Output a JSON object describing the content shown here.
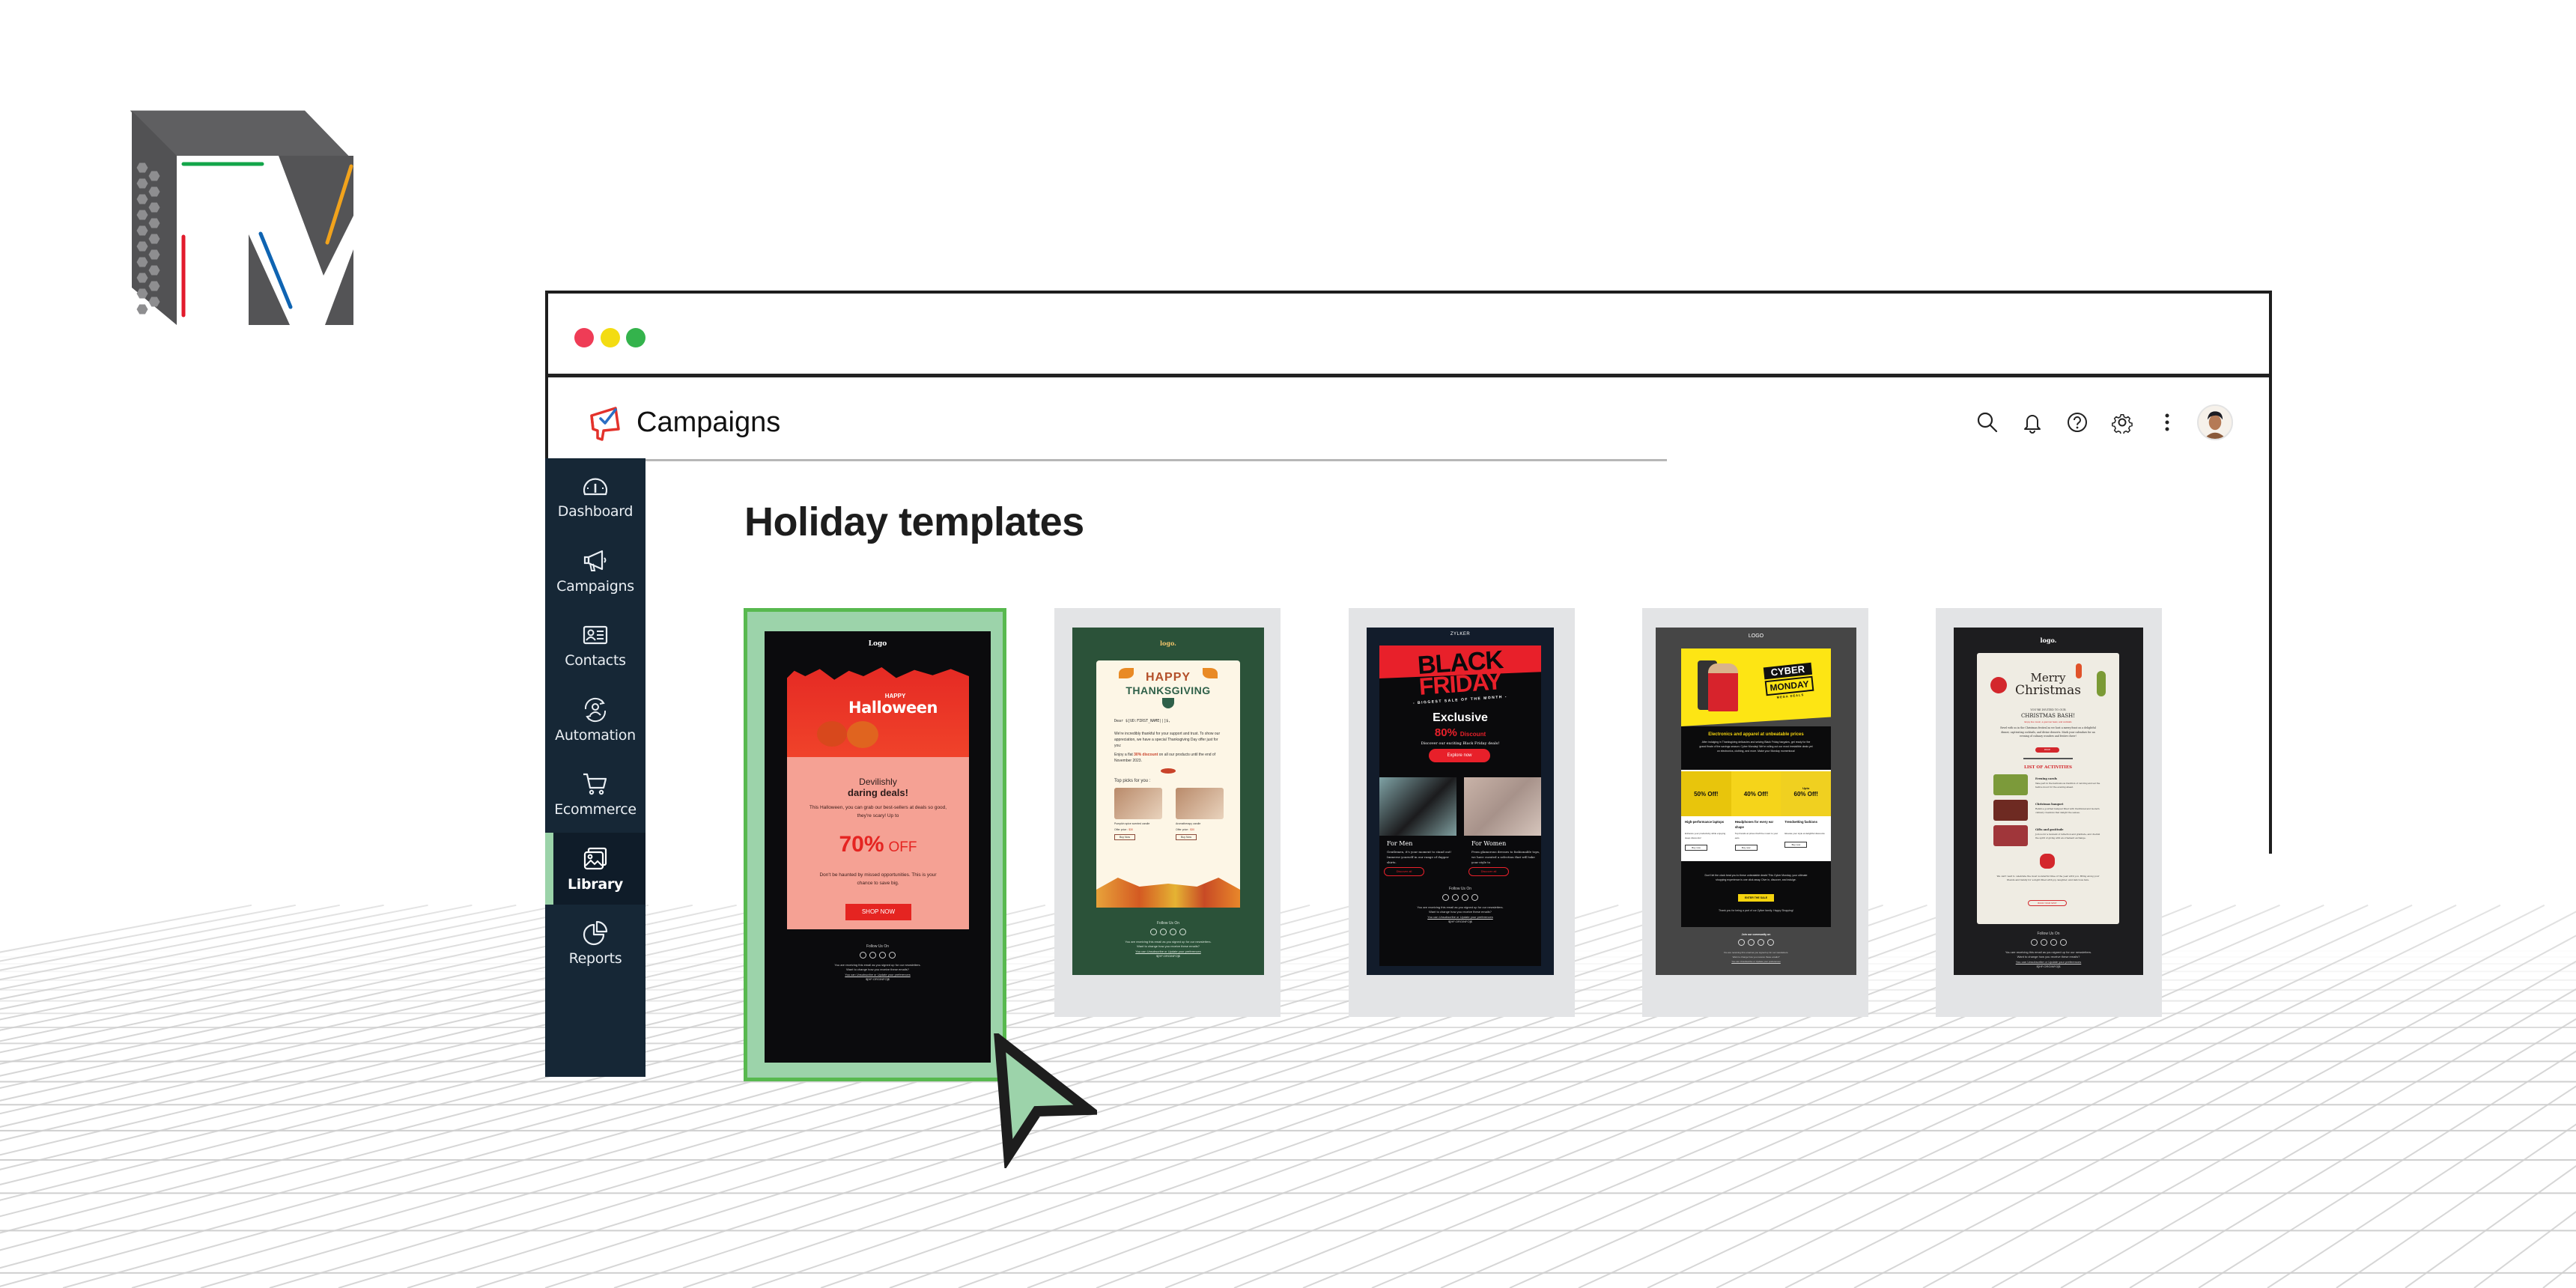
{
  "window": {
    "traffic_lights": [
      "close",
      "minimize",
      "maximize"
    ]
  },
  "app": {
    "name": "Campaigns",
    "logo_icon": "megaphone-check-icon"
  },
  "header_icons": [
    {
      "name": "search-icon",
      "label": "Search"
    },
    {
      "name": "bell-icon",
      "label": "Notifications"
    },
    {
      "name": "help-icon",
      "label": "Help"
    },
    {
      "name": "gear-icon",
      "label": "Settings"
    },
    {
      "name": "more-vertical-icon",
      "label": "More"
    },
    {
      "name": "avatar",
      "label": "User profile"
    }
  ],
  "sidebar": {
    "active": "Library",
    "items": [
      {
        "label": "Dashboard",
        "icon": "gauge-icon"
      },
      {
        "label": "Campaigns",
        "icon": "megaphone-icon"
      },
      {
        "label": "Contacts",
        "icon": "id-card-icon"
      },
      {
        "label": "Automation",
        "icon": "user-cycle-icon"
      },
      {
        "label": "Ecommerce",
        "icon": "cart-icon"
      },
      {
        "label": "Library",
        "icon": "images-icon"
      },
      {
        "label": "Reports",
        "icon": "pie-chart-icon"
      }
    ]
  },
  "page": {
    "title": "Holiday templates"
  },
  "templates": [
    {
      "name": "Halloween",
      "selected": true,
      "logo": "Logo",
      "banner_small": "HAPPY",
      "banner_big": "Halloween",
      "headline_1": "Devilishly",
      "headline_2": "daring deals!",
      "body_1": "This Halloween, you can grab our best-sellers at deals so good, they're scary! Up to",
      "offer_value": "70%",
      "offer_suffix": "OFF",
      "body_2": "Don't be haunted by missed opportunities. This is your chance to save big.",
      "cta": "SHOP NOW",
      "follow": "Follow Us On",
      "footer_1": "You are receiving this email as you signed up for our newsletters.",
      "footer_2": "Want to change how you receive these emails?",
      "footer_3": "You can Unsubscribe or Update your preferences",
      "footer_4": "$[HF:ORGINFO]$",
      "colors": {
        "bg": "#0b0b0d",
        "banner": "#e8302a",
        "panel": "#f5a194",
        "accent": "#e52421"
      }
    },
    {
      "name": "Thanksgiving",
      "selected": false,
      "logo": "logo.",
      "banner_small": "HAPPY",
      "banner_big": "THANKSGIVING",
      "greeting": "Dear $[UD:FIRST_NAME||]$,",
      "body_1": "We're incredibly thankful for your support and trust. To show our appreciation, we have a special Thanksgiving Day offer just for you:",
      "body_2_prefix": "Enjoy a flat",
      "offer": "30% discount",
      "body_2_suffix": "on all our products until the end of November 2023.",
      "picks_title": "Top picks for you :",
      "products": [
        {
          "name": "Pumpkin spice scented candle",
          "price_label": "Offer price :",
          "price": "$30",
          "cta": "Buy Now"
        },
        {
          "name": "Aromatherapy candle",
          "price_label": "Offer price :",
          "price": "$30",
          "cta": "Buy Now"
        }
      ],
      "follow": "Follow Us On",
      "footer_1": "You are receiving this email as you signed up for our newsletters.",
      "footer_2": "Want to change how you receive these emails?",
      "footer_3": "You can Unsubscribe or Update your preferences",
      "footer_4": "$[HF:ORGINFO]$",
      "colors": {
        "bg": "#2b5239",
        "panel": "#fdf6e6",
        "accent": "#c9432a",
        "green": "#2f6049",
        "orange": "#e98a25"
      }
    },
    {
      "name": "Black Friday",
      "selected": false,
      "logo": "ZYLKER",
      "banner_line_1": "BLACK",
      "banner_line_2": "FRIDAY",
      "banner_tagline": "- BIGGEST SALE OF THE MONTH -",
      "headline": "Exclusive",
      "offer_value": "80%",
      "offer_suffix": "Discount",
      "subline": "Discover our exciting Black Friday deals!",
      "cta": "Explore now",
      "sections": [
        {
          "title": "For Men",
          "body": "Gentlemen, it's your moment to stand out! Immerse yourself in our range of dapper shirts.",
          "cta": "Discover all"
        },
        {
          "title": "For Women",
          "body": "From glamorous dresses to fashionable tops, we have curated a selection that will take your style to",
          "cta": "Discover all"
        }
      ],
      "follow": "Follow Us On",
      "footer_1": "You are receiving this email as you signed up for our newsletters.",
      "footer_2": "Want to change how you receive these emails?",
      "footer_3": "You can Unsubscribe or Update your preferences",
      "footer_4": "$[HF:ORGINFO]$",
      "colors": {
        "bg": "#121c2b",
        "inner": "#0a0a0c",
        "accent": "#e8202a"
      }
    },
    {
      "name": "Cyber Monday",
      "selected": false,
      "logo": "LOGO",
      "banner_line_1": "CYBER",
      "banner_line_2": "MONDAY",
      "banner_tagline": "MEGA DEALS",
      "headline": "Electronics and apparel at unbeatable prices",
      "body_1": "After indulging in Thanksgiving delicacies and seizing Black Friday bargains, get ready for the grand finale of the savings season: Cyber Monday! We're rolling out our most irresistible deals yet on electronics, clothing, and more. Make your Monday momentous!",
      "deals": [
        {
          "prefix": "",
          "value": "50% Off!",
          "title": "High-performance laptops",
          "body": "Enhance your productivity while enjoying steep discounts!",
          "cta": "Buy now"
        },
        {
          "prefix": "",
          "value": "40% Off!",
          "title": "Headphones for every ear shape",
          "body": "Top brands at prices that'll be music to your ears.",
          "cta": "Buy now"
        },
        {
          "prefix": "Upto",
          "value": "60% Off!",
          "title": "Trendsetting fashions",
          "body": "Elevate your style at delightful discounts",
          "cta": "Buy now"
        }
      ],
      "body_2": "Don't let the clock beat you to these unbeatable deals! This Cyber Monday, your ultimate shopping experience is one click away. Dive in, discover, and indulge.",
      "cta": "ENTER THE SALE",
      "thanks": "Thank you for being a part of our Zylker family. Happy Shopping!",
      "follow": "Join our community on",
      "footer_1": "You are receiving this email as you signed up for our newsletters.",
      "footer_2": "Want to change how you receive these emails?",
      "footer_3": "You can Unsubscribe or Update your preferences",
      "colors": {
        "bg": "#464646",
        "banner": "#fde514",
        "inner": "#0b0b0c",
        "accent": "#f5d40e"
      }
    },
    {
      "name": "Christmas",
      "selected": false,
      "logo": "logo.",
      "banner_line_1": "Merry",
      "banner_line_2": "Christmas",
      "invite": "YOU'RE INVITED TO OUR",
      "headline": "CHRISTMAS BASH!",
      "subline": "Enjoy live music, a gourmet feast, and cocktails",
      "body_1": "Revel with us in the Christmas festival as we host a merry feast on a delightful dinner, captivating cocktails, and divine desserts. Mark your calendars for an evening of culinary wonders and festive cheer!",
      "cta": "RSVP",
      "activities_title": "LIST OF ACTIVITIES",
      "activities": [
        {
          "title": "Evening carols",
          "body": "Take part in the harmonious tradition of caroling and set the festive mood for the evening ahead."
        },
        {
          "title": "Christmas banquet",
          "body": "Relish a gourmet banquet filled with traditional and modern culinary creations that delight the senses."
        },
        {
          "title": "Gifts and gratitude",
          "body": "Join us for a moment of reflection and gratitude, and cherish the spirit of giving with an ornament exchange."
        }
      ],
      "closing": "We can't wait to celebrate the most wonderful time of the year with you. Bring along your friends and family for a night filled with joy, laughter, and delicious fare.",
      "cta_2": "BOOK YOUR SPOT",
      "follow": "Follow Us On",
      "footer_1": "You are receiving this email as you signed up for our newsletters.",
      "footer_2": "Want to change how you receive these emails?",
      "footer_3": "You can Unsubscribe or Update your preferences",
      "footer_4": "$[HF:ORGINFO]$",
      "colors": {
        "bg": "#1d1d1f",
        "panel": "#efece3",
        "accent": "#d3272c",
        "green": "#7b9a35"
      }
    }
  ],
  "colors": {
    "sidebar_bg": "#162736",
    "sidebar_active_bg": "#0f1c29",
    "sidebar_active_marker": "#9bd3a9",
    "selection_fill": "#9cd3aa",
    "selection_border": "#58b94f",
    "card_frame": "#e3e4e6"
  }
}
